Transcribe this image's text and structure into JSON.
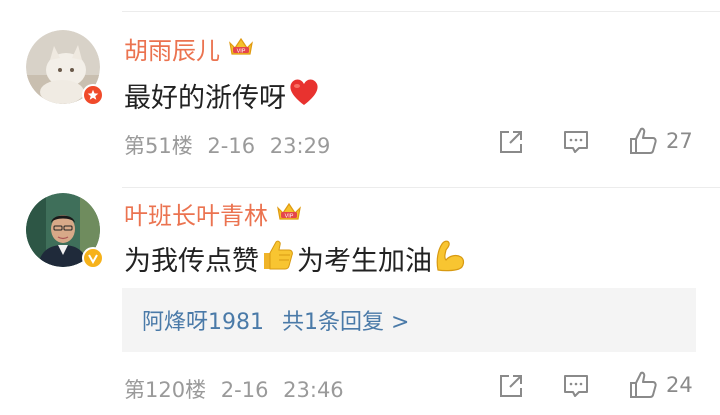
{
  "comments": [
    {
      "username": "胡雨辰儿",
      "text_before": "最好的浙传呀",
      "floor": "第51楼",
      "date": "2-16",
      "time": "23:29",
      "likes": "27"
    },
    {
      "username": "叶班长叶青林",
      "text_part1": "为我传点赞",
      "text_part2": "为考生加油",
      "floor": "第120楼",
      "date": "2-16",
      "time": "23:46",
      "likes": "24",
      "reply_preview": {
        "user": "阿烽呀1981",
        "summary": "共1条回复 >"
      }
    }
  ],
  "icons": {
    "verified_red": "weibo-red-verified-icon",
    "verified_gold": "gold-verified-icon",
    "vip": "vip-crown-icon",
    "share": "share-icon",
    "comment": "comment-icon",
    "like": "like-thumb-icon"
  },
  "colors": {
    "username": "#eb7350",
    "reply_link": "#4a7aa8",
    "meta": "#9a9a9a"
  }
}
